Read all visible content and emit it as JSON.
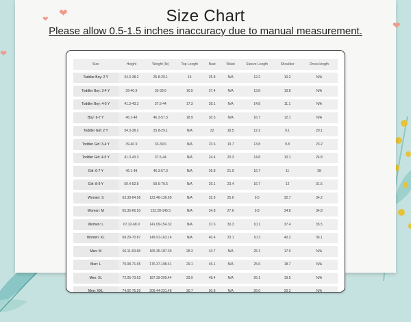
{
  "header": {
    "title": "Size Chart",
    "note": "Please allow 0.5-1.5 inches inaccuracy due to manual measurement."
  },
  "colors": {
    "background": "#c6e2e0",
    "paper": "#f7f7f5",
    "heart": "#f19a8f",
    "row": "#efefef"
  },
  "table": {
    "headers": [
      "Size",
      "Height",
      "Weight (lb)",
      "Top Length",
      "Bust",
      "Waist",
      "Sleeve Length",
      "Shoulder",
      "Dress length"
    ],
    "rows": [
      [
        "Toddler Boy: 2 Y",
        "34.3-38.2",
        "25.8-29.1",
        "15",
        "25.8",
        "N/A",
        "12.2",
        "10.2",
        "N/A"
      ],
      [
        "Toddler Boy: 3-4 Y",
        "39-40.9",
        "33-39.6",
        "16.5",
        "27.4",
        "N/A",
        "13.8",
        "10.8",
        "N/A"
      ],
      [
        "Toddler Boy: 4-5 Y",
        "41.3-43.3",
        "37.5-44",
        "17.3",
        "28.1",
        "N/A",
        "14.8",
        "11.1",
        "N/A"
      ],
      [
        "Boy: 6-7 Y",
        "46.1-48",
        "46.3-57.3",
        "18.9",
        "30.5",
        "N/A",
        "16.7",
        "12.1",
        "N/A"
      ],
      [
        "Toddler Girl: 2 Y",
        "34.3-38.2",
        "25.8-29.1",
        "N/A",
        "22",
        "18.5",
        "12.2",
        "9.1",
        "20.1"
      ],
      [
        "Toddler Girl: 3-4 Y",
        "39-40.9",
        "33-39.6",
        "N/A",
        "23.6",
        "19.7",
        "13.8",
        "9.8",
        "23.2"
      ],
      [
        "Toddler Girl: 4-5 Y",
        "41.3-43.3",
        "37.5-44",
        "N/A",
        "24.4",
        "20.3",
        "14.8",
        "10.1",
        "24.8"
      ],
      [
        "Girl: 6-7 Y",
        "46.1-48",
        "46.3-57.3",
        "N/A",
        "26.8",
        "21.9",
        "16.7",
        "11",
        "28"
      ],
      [
        "Girl: 8-9 Y",
        "50.4-52.8",
        "59.5-70.5",
        "N/A",
        "29.1",
        "23.4",
        "16.7",
        "12",
        "31.5"
      ],
      [
        "Women: S",
        "63.39-64.96",
        "123.46-136.69",
        "N/A",
        "32.9",
        "25.6",
        "9.6",
        "32.7",
        "34.2"
      ],
      [
        "Women: M",
        "65.35-66.93",
        "132.28-145.5",
        "N/A",
        "34.8",
        "27.6",
        "9.8",
        "34.8",
        "34.8"
      ],
      [
        "Women: L",
        "67.32-68.9",
        "141.09-154.32",
        "N/A",
        "37.6",
        "30.3",
        "10.1",
        "37.4",
        "35.5"
      ],
      [
        "Women: XL",
        "68.29-70.87",
        "149.91-163.14",
        "N/A",
        "40.4",
        "33.1",
        "10.3",
        "40.2",
        "36.1"
      ],
      [
        "Men: M",
        "66.11-69.68",
        "165.35-187.39",
        "28.3",
        "43.7",
        "N/A",
        "25.1",
        "17.9",
        "N/A"
      ],
      [
        "Men: L",
        "70.08-71.65",
        "176.37-198.41",
        "29.1",
        "46.1",
        "N/A",
        "25.6",
        "18.7",
        "N/A"
      ],
      [
        "Men: XL",
        "72.05-73.62",
        "187.39-209.44",
        "29.9",
        "48.4",
        "N/A",
        "26.1",
        "19.5",
        "N/A"
      ],
      [
        "Men: XXL",
        "74.02-75.59",
        "209.44-231.48",
        "30.7",
        "50.8",
        "N/A",
        "26.6",
        "20.3",
        "N/A"
      ]
    ]
  },
  "decor": {
    "hearts": [
      "heart-icon",
      "heart-icon",
      "heart-icon",
      "heart-icon"
    ],
    "leaves": [
      "leaf-icon",
      "flower-icon"
    ]
  }
}
